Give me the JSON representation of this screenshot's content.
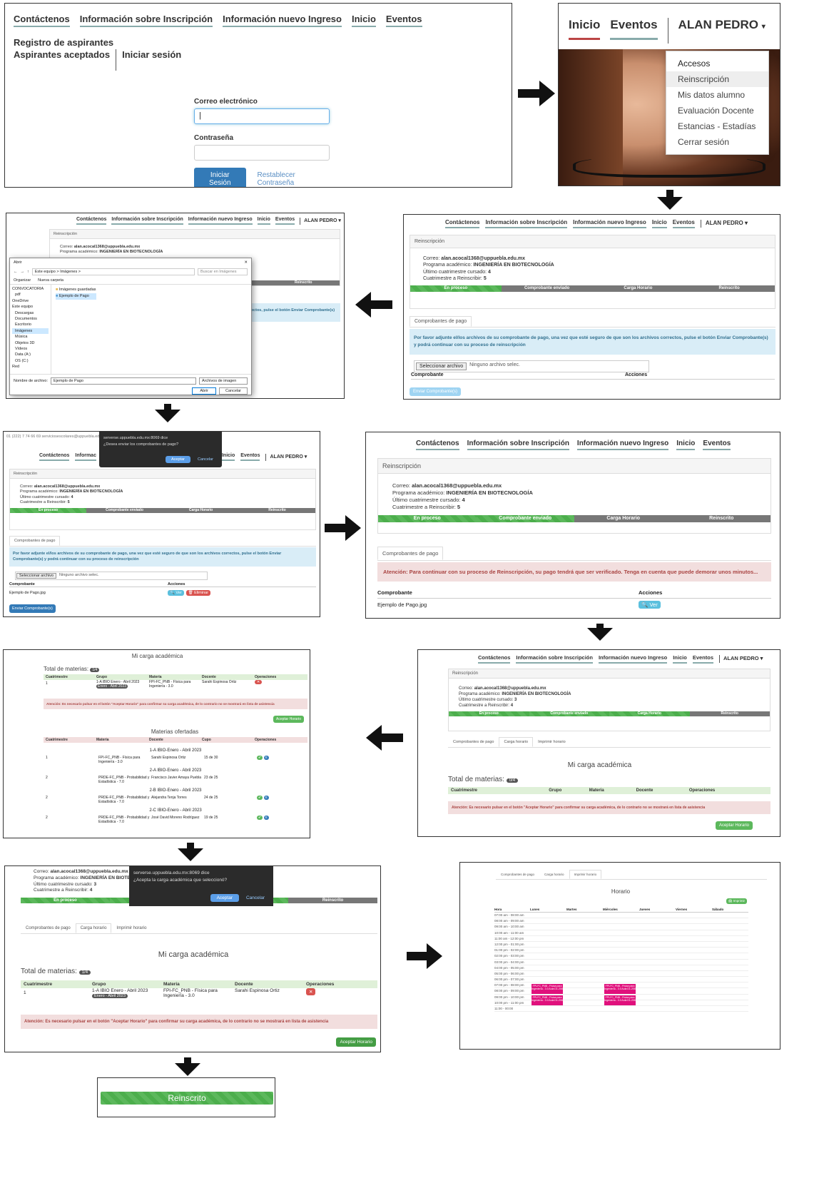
{
  "panel1": {
    "nav": [
      "Contáctenos",
      "Información sobre Inscripción",
      "Información nuevo Ingreso",
      "Inicio",
      "Eventos",
      "Registro de aspirantes"
    ],
    "nav2": [
      "Aspirantes aceptados",
      "Iniciar sesión"
    ],
    "email_label": "Correo electrónico",
    "email_value": "|",
    "password_label": "Contraseña",
    "login_button": "Iniciar Sesión",
    "reset_link": "Restablecer Contraseña"
  },
  "panel2": {
    "nav": [
      "Inicio",
      "Eventos"
    ],
    "user": "ALAN PEDRO",
    "menu": [
      "Accesos",
      "Reinscripción",
      "Mis datos alumno",
      "Evaluación Docente",
      "Estancias - Estadías",
      "Cerrar sesión"
    ]
  },
  "nav_full": [
    "Contáctenos",
    "Información sobre Inscripción",
    "Información nuevo Ingreso",
    "Inicio",
    "Eventos"
  ],
  "user": "ALAN PEDRO",
  "reinscripcion": {
    "title": "Reinscripción",
    "correo_label": "Correo:",
    "correo": "alan.acocal1368@uppuebla.edu.mx",
    "programa_label": "Programa académico:",
    "programa": "INGENIERÍA EN BIOTECNOLOGÍA",
    "ultimo_label": "Último cuatrimestre cursado:",
    "ultimo": "4",
    "reinscribir_label": "Cuatrimestre a Reinscribir:",
    "reinscribir": "5",
    "steps": [
      "En proceso",
      "Comprobante enviado",
      "Carga Horario",
      "Reinscrito"
    ]
  },
  "pago": {
    "tab": "Comprobantes de pago",
    "info": "Por favor adjunte el/los archivos de su comprobante de pago, una vez que esté seguro de que son los archivos correctos, pulse el botón Enviar Comprobante(s) y podrá continuar con su proceso de reinscripción",
    "select_button": "Seleccionar archivo",
    "no_file": "Ninguno archivo selec.",
    "col_comprobante": "Comprobante",
    "col_acciones": "Acciones",
    "send_button": "Enviar Comprobante(s)",
    "file_name": "Ejemplo de Pago.jpg",
    "ver": "Ver",
    "eliminar": "Eliminar",
    "warning": "Atención: Para continuar con su proceso de Reinscripción, su pago tendrá que ser verificado. Tenga en cuenta que puede demorar unos minutos..."
  },
  "file_dialog": {
    "title": "Abrir",
    "path": "Este equipo > Imágenes >",
    "search": "Buscar en Imágenes",
    "organize": "Organizar",
    "new_folder": "Nueva carpeta",
    "tree": [
      "CONVOCATORIA",
      "pdf",
      "OneDrive",
      "Este equipo",
      "Descargas",
      "Documentos",
      "Escritorio",
      "Imágenes",
      "Música",
      "Objetos 3D",
      "Vídeos",
      "Data (A:)",
      "OS (C:)",
      "Red"
    ],
    "files": [
      "Imágenes guardadas",
      "Ejemplo de Pago"
    ],
    "filename_label": "Nombre de archivo:",
    "filename": "Ejemplo de Pago",
    "filter": "Archivos de imagen",
    "open": "Abrir",
    "cancel": "Cancelar"
  },
  "confirm1": {
    "site": "serverse.uppuebla.edu.mx:8069 dice",
    "message": "¿Desea enviar los comprobantes de pago?",
    "ok": "Aceptar",
    "cancel": "Cancelar"
  },
  "confirm2": {
    "site": "serverse.uppuebla.edu.mx:8069 dice",
    "message": "¿Acepta la carga académica que seleccionó?",
    "ok": "Aceptar",
    "cancel": "Cancelar"
  },
  "browser_bar": "01 (222) 7 74 66 69   serviciosescolares@uppuebla.edu.mx",
  "carga": {
    "tabs": [
      "Comprobantes de pago",
      "Carga horario",
      "Imprimir horario"
    ],
    "title": "Mi carga académica",
    "total_label": "Total de materias:",
    "total": "0/4",
    "total_one": "1/4",
    "cols": [
      "Cuatrimestre",
      "Grupo",
      "Materia",
      "Docente",
      "Operaciones"
    ],
    "row": {
      "cuat": "1",
      "grupo": "1-A IBIO Enero - Abril 2023",
      "badge": "Enero - Abril 2023",
      "materia": "FPI-FC_PNB - Física para Ingeniería - 3.0",
      "docente": "Sarahi Espinosa Ortiz"
    },
    "warning": "Atención: Es necesario pulsar en el botón \"Aceptar Horario\" para confirmar su carga académica, de lo contrario no se mostrará en lista de asistencia",
    "accept": "Aceptar Horario",
    "ofertadas": "Materias ofertadas",
    "ofert_cols": [
      "Cuatrimestre",
      "Materia",
      "Docente",
      "Cupo",
      "Operaciones"
    ],
    "groups": [
      {
        "name": "1-A IBIO-Enero - Abril 2023",
        "cuat": "1",
        "materia": "FPI-FC_PNB - Física para Ingeniería - 3.0",
        "docente": "Sarahi Espinosa Ortiz",
        "cupo": "15 de 30"
      },
      {
        "name": "2-A IBIO-Enero - Abril 2023",
        "cuat": "2",
        "materia": "PRDE-FC_PNB - Probabilidad y Estadística - 7.0",
        "docente": "Francisco Javier Amaya Puebla",
        "cupo": "23 de 25"
      },
      {
        "name": "2-B IBIO-Enero - Abril 2023",
        "cuat": "2",
        "materia": "PRDE-FC_PNB - Probabilidad y Estadística - 7.0",
        "docente": "Alejandra Tenja Torres",
        "cupo": "24 de 25"
      },
      {
        "name": "2-C IBIO-Enero - Abril 2023",
        "cuat": "2",
        "materia": "PRDE-FC_PNB - Probabilidad y Estadística - 7.0",
        "docente": "José David Moreno Rodríguez",
        "cupo": "19 de 25"
      }
    ],
    "ultimo3": "3",
    "reinscribir4": "4"
  },
  "horario": {
    "title": "Horario",
    "print": "Imprimir",
    "cols": [
      "Hora",
      "Lunes",
      "Martes",
      "Miércoles",
      "Jueves",
      "Viernes",
      "Sábado"
    ],
    "hours": [
      "07:00 am - 08:00 am",
      "08:00 am - 09:00 am",
      "09:00 am - 10:00 am",
      "10:00 am - 11:00 am",
      "11:00 am - 12:00 pm",
      "12:00 pm - 01:00 pm",
      "01:00 pm - 02:00 pm",
      "02:00 pm - 03:00 pm",
      "03:00 pm - 04:00 pm",
      "04:00 pm - 05:00 pm",
      "05:00 pm - 06:00 pm",
      "06:00 pm - 07:00 pm",
      "07:00 pm - 08:00 pm",
      "08:00 pm - 09:00 pm",
      "09:00 pm - 10:00 pm",
      "10:00 pm - 11:00 pm",
      "11:00 - 00:00"
    ],
    "event": "FPI-FC_PNB - Física para Ingeniería - 3.0 Aula D1-206"
  },
  "final": {
    "label": "Reinscrito"
  },
  "colors": {
    "green": "#5cb85c",
    "blue": "#337ab7",
    "red": "#d9534f",
    "magenta": "#e0107c",
    "alert_blue": "#d9edf7",
    "alert_red": "#f2dede"
  }
}
